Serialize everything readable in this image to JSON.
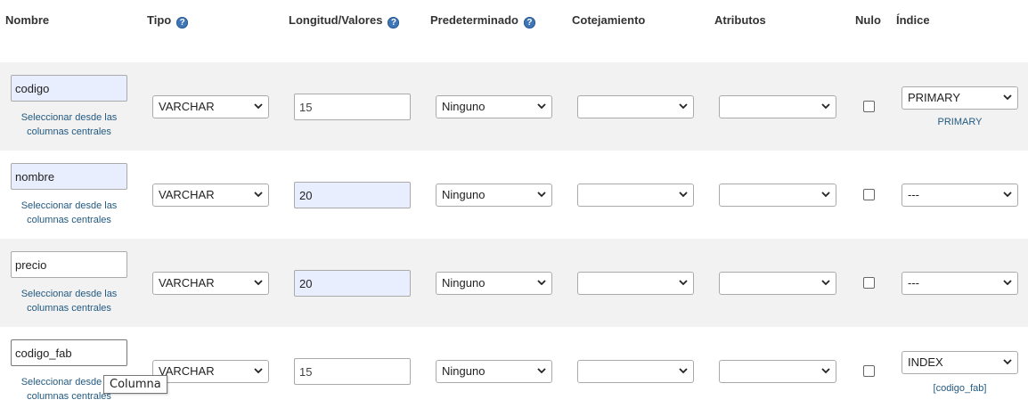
{
  "headers": {
    "nombre": "Nombre",
    "tipo": "Tipo",
    "longitud": "Longitud/Valores",
    "predeterminado": "Predeterminado",
    "cotejamiento": "Cotejamiento",
    "atributos": "Atributos",
    "nulo": "Nulo",
    "indice": "Índice"
  },
  "central_link_line1": "Seleccionar desde las",
  "central_link_line2": "columnas centrales",
  "rows": [
    {
      "name": "codigo",
      "type": "VARCHAR",
      "length": "15",
      "default": "Ninguno",
      "collation": "",
      "attributes": "",
      "null": false,
      "index": "PRIMARY",
      "index_info": "PRIMARY"
    },
    {
      "name": "nombre",
      "type": "VARCHAR",
      "length": "20",
      "default": "Ninguno",
      "collation": "",
      "attributes": "",
      "null": false,
      "index": "---",
      "index_info": ""
    },
    {
      "name": "precio",
      "type": "VARCHAR",
      "length": "20",
      "default": "Ninguno",
      "collation": "",
      "attributes": "",
      "null": false,
      "index": "---",
      "index_info": ""
    },
    {
      "name": "codigo_fab",
      "type": "VARCHAR",
      "length": "15",
      "default": "Ninguno",
      "collation": "",
      "attributes": "",
      "null": false,
      "index": "INDEX",
      "index_info": "[codigo_fab]"
    }
  ],
  "tooltip": "Columna"
}
